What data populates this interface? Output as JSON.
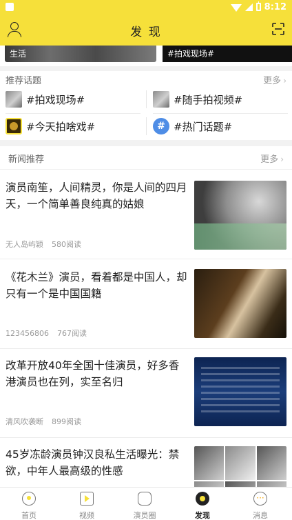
{
  "status_bar": {
    "time": "8:12"
  },
  "header": {
    "title": "发 现"
  },
  "banners": [
    {
      "label": "生活"
    },
    {
      "label": "#拍戏现场#"
    }
  ],
  "topics": {
    "title": "推荐话题",
    "more": "更多",
    "items": [
      {
        "label": "#拍戏现场#",
        "icon": "photo-thumb"
      },
      {
        "label": "#随手拍视频#",
        "icon": "photo-thumb"
      },
      {
        "label": "#今天拍啥戏#",
        "icon": "badge-thumb"
      },
      {
        "label": "#热门话题#",
        "icon": "hash-icon"
      }
    ]
  },
  "news": {
    "title": "新闻推荐",
    "more": "更多",
    "articles": [
      {
        "title": "演员南笙，人间精灵，你是人间的四月天，一个简单善良纯真的姑娘",
        "author": "无人岛屿颖",
        "reads": "580阅读"
      },
      {
        "title": "《花木兰》演员，看着都是中国人，却只有一个是中国国籍",
        "author": "123456806",
        "reads": "767阅读"
      },
      {
        "title": "改革开放40年全国十佳演员，好多香港演员也在列，实至名归",
        "author": "清风吹袭断",
        "reads": "899阅读"
      },
      {
        "title": "45岁冻龄演员钟汉良私生活曝光：禁欲，中年人最高级的性感",
        "author": "",
        "reads": ""
      }
    ]
  },
  "bottom_nav": [
    {
      "label": "首页",
      "icon": "home-icon"
    },
    {
      "label": "视频",
      "icon": "video-icon"
    },
    {
      "label": "演员圈",
      "icon": "actor-circle-icon"
    },
    {
      "label": "发现",
      "icon": "discover-icon",
      "active": true
    },
    {
      "label": "消息",
      "icon": "message-icon"
    }
  ],
  "colors": {
    "accent": "#f6e03a",
    "text": "#222222",
    "muted": "#999999"
  }
}
